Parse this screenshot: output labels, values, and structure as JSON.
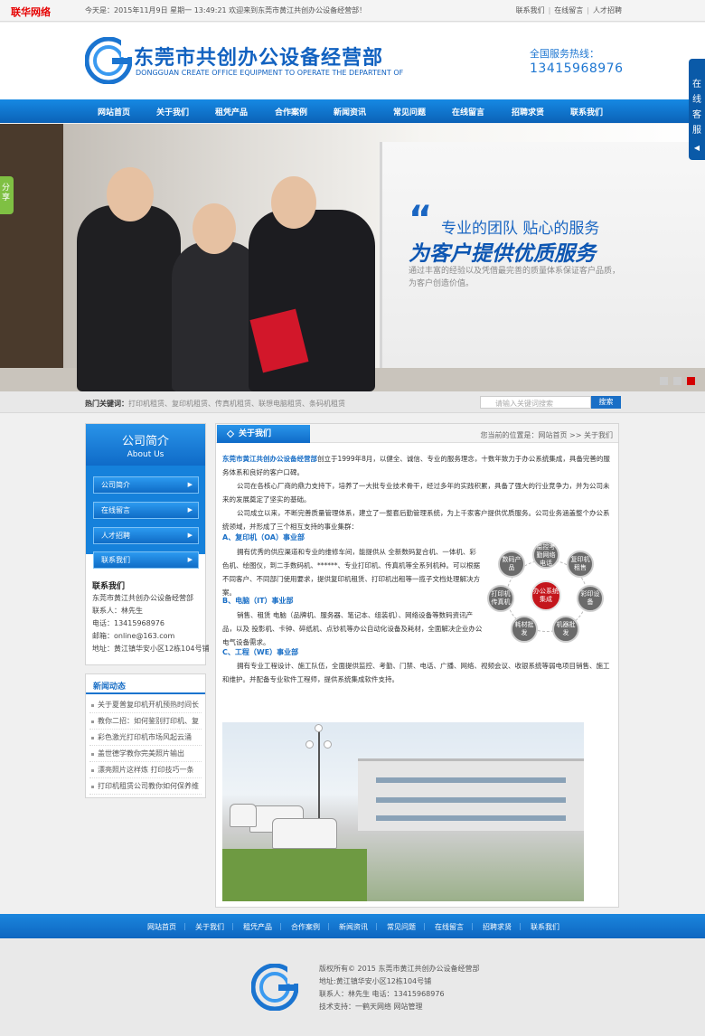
{
  "site_tag": "联华网络",
  "topbar": {
    "date_text": "今天是：2015年11月9日  星期一  13:49:21  欢迎来到东莞市黄江共创办公设备经营部！",
    "links": [
      "联系我们",
      "在线留言",
      "人才招聘"
    ]
  },
  "header": {
    "company_cn": "东莞市共创办公设备经营部",
    "company_en": "DONGGUAN CREATE OFFICE EQUIPMENT TO OPERATE THE DEPARTENT OF",
    "hotline_label": "全国服务热线：",
    "hotline_number": "13415968976"
  },
  "nav": [
    "网站首页",
    "关于我们",
    "租凭产品",
    "合作案例",
    "新闻资讯",
    "常见问题",
    "在线留言",
    "招聘求贤",
    "联系我们"
  ],
  "banner": {
    "quote": "“",
    "slogan_line1": "专业的团队 贴心的服务",
    "slogan_line2": "为客户提供优质服务",
    "slogan_line3": "通过丰富的经验以及凭借最完善的质量体系保证客户品质，为客户创造价值。",
    "slides_total": 3,
    "active_slide": 3
  },
  "share_tab": "分享",
  "service_tab": "在线客服",
  "keywords": {
    "label": "热门关键词：",
    "list": "打印机租赁、复印机租赁、传真机租赁、联想电脑租赁、条码机租赁",
    "search_placeholder": "请输入关键词搜索",
    "search_button": "搜索"
  },
  "sidebar": {
    "about_title": "公司简介",
    "about_sub": "About Us",
    "menu": [
      "公司简介",
      "在线留言",
      "人才招聘",
      "联系我们"
    ],
    "contact_title": "联系我们",
    "contact_lines": [
      "东莞市黄江共创办公设备经营部",
      "联系人：林先生",
      "电话：13415968976",
      "邮箱：online@163.com",
      "地址：黄江镇华安小区12栋104号铺"
    ],
    "news_title": "新闻动态",
    "news": [
      "关于夏普复印机开机预热时间长",
      "教你二招：如何鉴别打印机、复",
      "彩色激光打印机市场风起云涌",
      "盖世德学教你完美照片输出",
      "漂亮照片这样炼 打印技巧一条",
      "打印机租赁公司教你如何保养维"
    ]
  },
  "main": {
    "tab_title": "关于我们",
    "breadcrumb": "您当前的位置是：网站首页 >> 关于我们",
    "company_name": "东莞市黄江共创办公设备经营部",
    "intro_rest": "创立于1999年8月，以健全、诚信、专业的服务理念，十数年致力于办公系统集成，具备完善的服务体系和良好的客户口碑。",
    "p2": "公司在各核心厂商的鼎力支持下，培养了一大批专业技术骨干，经过多年的实践积累，具备了强大的行业竞争力，并为公司未来的发展奠定了坚实的基础。",
    "p3": "公司成立以来，不断完善质量管理体系，建立了一整套后勤管理系统，为上千家客户提供优质服务。公司业务涵盖整个办公系统领域，并形成了三个相互支持的事业集群：",
    "sec_a_title": "A、复印机（OA）事业部",
    "sec_a_body": "拥有优秀的供应渠道和专业的维修车间，能提供从 全新数码复合机、一体机、彩色机、绘图仪，到二手数码机、******、专业打印机、传真机等全系列机种。可以根据不同客户、不同部门使用要求，提供复印机租赁、打印机出租等一揽子文档处理解决方案。",
    "sec_b_title": "B、电脑（IT）事业部",
    "sec_b_body": "销售、租赁 电脑（品牌机、服务器、笔记本、组装机）、网络设备等数码资讯产品，以及 投影机、卡钟、碎纸机、点钞机等办公自动化设备及耗材，全面解决企业办公电气设备需求。",
    "sec_c_title": "C、工程（WE）事业部",
    "sec_c_body": "拥有专业工程设计、施工队伍，全面提供监控、考勤、门禁、电话、广播、网络、视频会议、收银系统等弱电项目销售、施工和维护。并配备专业软件工程师，提供系统集成软件支持。",
    "diagram": {
      "center": "办公系统集成",
      "nodes": [
        "数码产品",
        "监控考勤网络电话",
        "复印机租售",
        "彩印设备",
        "机器批发",
        "耗材批发",
        "打印机传真机"
      ]
    }
  },
  "footer_nav": [
    "网站首页",
    "关于我们",
    "租凭产品",
    "合作案例",
    "新闻资讯",
    "常见问题",
    "在线留言",
    "招聘求贤",
    "联系我们"
  ],
  "footer": {
    "lines": [
      "版权所有© 2015 东莞市黄江共创办公设备经营部",
      "地址:黄江镇华安小区12栋104号铺",
      "联系人：林先生  电话：13415968976",
      "技术支持：一鹤天网络  网站管理"
    ]
  },
  "colors": {
    "brand_blue": "#1262c0",
    "nav_blue": "#0b62b7",
    "accent_red": "#c4161c",
    "site_tag_red": "#e60000"
  }
}
